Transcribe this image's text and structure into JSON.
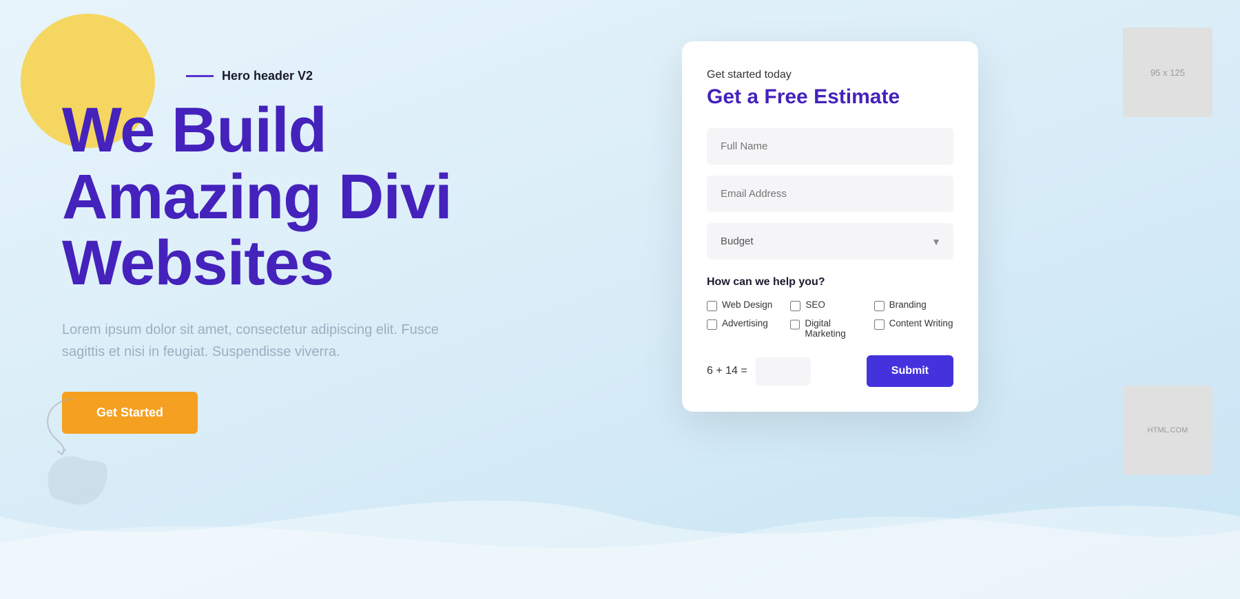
{
  "header": {
    "label": "Hero header V2"
  },
  "hero": {
    "title_line1": "We Build",
    "title_line2": "Amazing Divi",
    "title_line3": "Websites",
    "description": "Lorem ipsum dolor sit amet, consectetur adipiscing elit. Fusce sagittis et nisi in feugiat. Suspendisse viverra.",
    "cta_label": "Get Started"
  },
  "form": {
    "subtitle": "Get started today",
    "title": "Get a Free Estimate",
    "full_name_placeholder": "Full Name",
    "email_placeholder": "Email Address",
    "budget_placeholder": "Budget",
    "help_label": "How can we help you?",
    "checkboxes": [
      {
        "id": "web-design",
        "label": "Web Design"
      },
      {
        "id": "seo",
        "label": "SEO"
      },
      {
        "id": "branding",
        "label": "Branding"
      },
      {
        "id": "advertising",
        "label": "Advertising"
      },
      {
        "id": "digital-marketing",
        "label": "Digital Marketing"
      },
      {
        "id": "content-writing",
        "label": "Content Writing"
      }
    ],
    "captcha_equation": "6 + 14 =",
    "submit_label": "Submit"
  },
  "right_images": {
    "top_label": "95 x 125",
    "bottom_label": "HTML.COM"
  },
  "colors": {
    "accent_purple": "#4422bb",
    "accent_orange": "#f5a020",
    "submit_blue": "#4433dd",
    "background": "#ddeef8"
  }
}
